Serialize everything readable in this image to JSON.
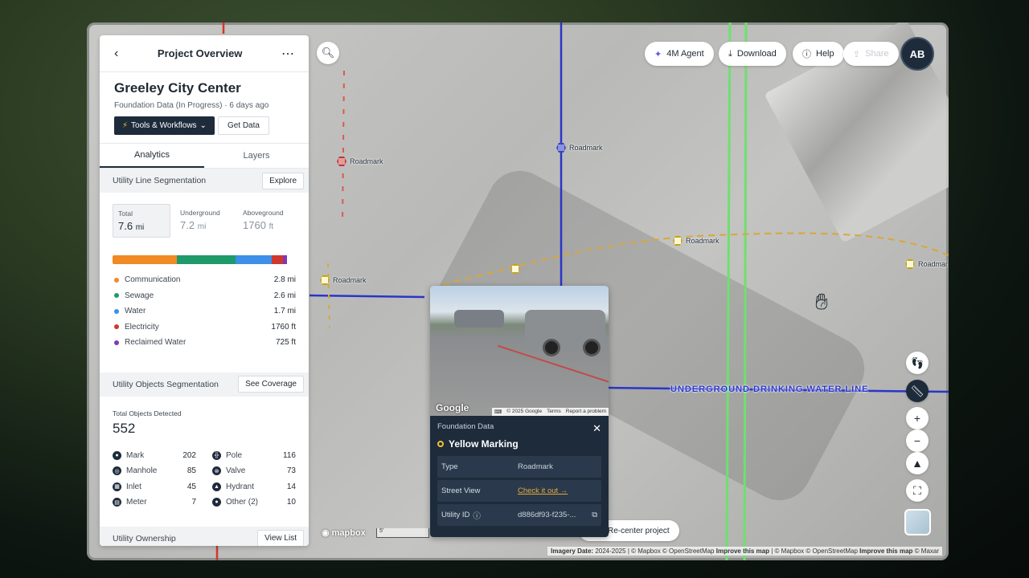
{
  "panel": {
    "header_title": "Project Overview",
    "project_name": "Greeley City Center",
    "project_status": "Foundation Data (In Progress) · 6 days ago",
    "tools_button": "Tools & Workflows",
    "get_data_button": "Get Data",
    "tabs": [
      "Analytics",
      "Layers"
    ],
    "utility_line": {
      "title": "Utility Line Segmentation",
      "action": "Explore",
      "stats": [
        {
          "label": "Total",
          "value": "7.6",
          "unit": "mi"
        },
        {
          "label": "Underground",
          "value": "7.2",
          "unit": "mi"
        },
        {
          "label": "Aboveground",
          "value": "1760",
          "unit": "ft"
        }
      ],
      "bar_colors": [
        "#f08a24",
        "#1f9a6a",
        "#3d8fe8",
        "#d1372c",
        "#7d3bb3"
      ],
      "legend": [
        {
          "name": "Communication",
          "value": "2.8 mi",
          "color": "#f08a24"
        },
        {
          "name": "Sewage",
          "value": "2.6 mi",
          "color": "#1f9a6a"
        },
        {
          "name": "Water",
          "value": "1.7 mi",
          "color": "#3d8fe8"
        },
        {
          "name": "Electricity",
          "value": "1760 ft",
          "color": "#d1372c"
        },
        {
          "name": "Reclaimed Water",
          "value": "725 ft",
          "color": "#7d3bb3"
        }
      ]
    },
    "utility_objects": {
      "title": "Utility Objects Segmentation",
      "action": "See Coverage",
      "total_label": "Total Objects Detected",
      "total_value": "552",
      "items": [
        {
          "name": "Mark",
          "value": "202",
          "icon": "mark-icon"
        },
        {
          "name": "Pole",
          "value": "116",
          "icon": "pole-icon"
        },
        {
          "name": "Manhole",
          "value": "85",
          "icon": "manhole-icon"
        },
        {
          "name": "Valve",
          "value": "73",
          "icon": "valve-icon"
        },
        {
          "name": "Inlet",
          "value": "45",
          "icon": "inlet-icon"
        },
        {
          "name": "Hydrant",
          "value": "14",
          "icon": "hydrant-icon"
        },
        {
          "name": "Meter",
          "value": "7",
          "icon": "meter-icon"
        },
        {
          "name": "Other (2)",
          "value": "10",
          "icon": "other-icon"
        }
      ]
    },
    "utility_ownership": {
      "title": "Utility Ownership",
      "action": "View List"
    }
  },
  "toolbar": {
    "agent": "4M Agent",
    "download": "Download",
    "help": "Help",
    "share": "Share",
    "avatar": "AB"
  },
  "map": {
    "labels": [
      "Roadmark",
      "Roadmark",
      "Roadmark",
      "Roadmark",
      "Roadmark",
      "Roadmark",
      "Roadmark"
    ],
    "water_line_label": "UNDERGROUND DRINKING WATER LINE",
    "recenter": "Re-center project",
    "mapbox": "mapbox",
    "scale": "5'",
    "attribution_imagery": "Imagery Date:",
    "attribution_date": "2024-2025",
    "attribution_rest": "| © Mapbox © OpenStreetMap",
    "attribution_improve": "Improve this map",
    "attribution_rest2": "| © Mapbox © OpenStreetMap",
    "attribution_improve2": "Improve this map",
    "attribution_maxar": "© Maxar"
  },
  "popup": {
    "google": "Google",
    "footer": [
      "© 2025 Google",
      "Terms",
      "Report a problem"
    ],
    "subtitle": "Foundation Data",
    "title": "Yellow Marking",
    "rows": [
      {
        "key": "Type",
        "value": "Roadmark"
      },
      {
        "key": "Street View",
        "value": "Check it out →"
      },
      {
        "key": "Utility ID",
        "value": "d886df93-f235-..."
      }
    ]
  }
}
